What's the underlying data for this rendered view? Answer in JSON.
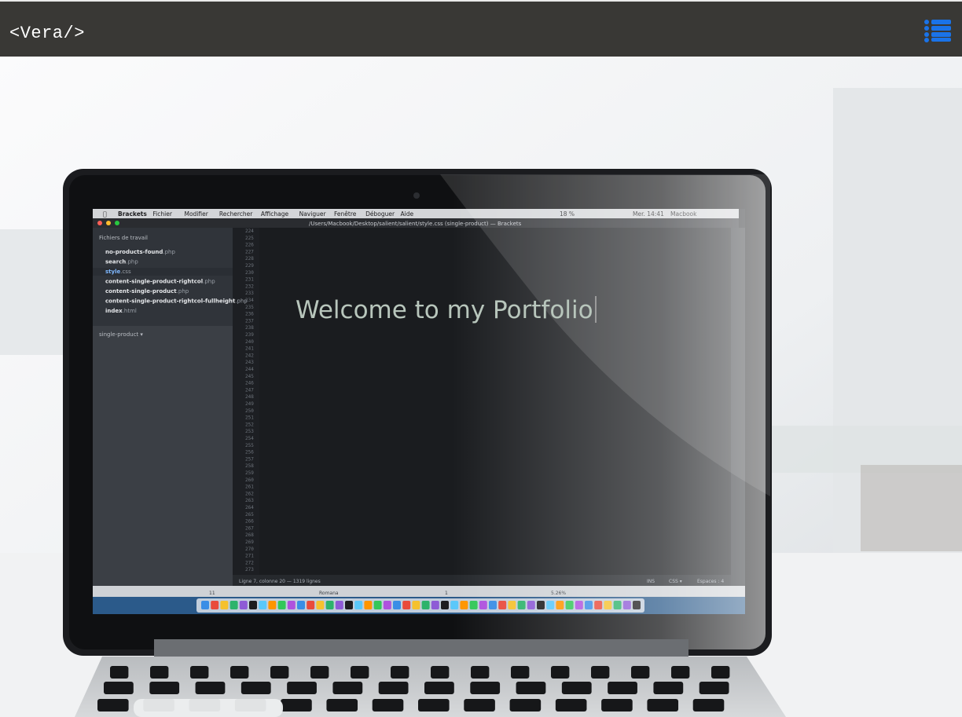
{
  "navbar": {
    "brand": "<Vera/>",
    "menu_icon": "list-icon",
    "accent_color": "#1a73e8",
    "background_color": "#393835"
  },
  "hero": {
    "headline": "Welcome to my Portfolio",
    "background_image": "laptop showing code editor on a white desk"
  },
  "editor_screen": {
    "menubar": [
      "Brackets",
      "Fichier",
      "Modifier",
      "Rechercher",
      "Affichage",
      "Naviguer",
      "Fenêtre",
      "Déboguer",
      "Aide"
    ],
    "window_title": "/Users/Macbook/Desktop/salient/salient/style.css (single-product) — Brackets",
    "clock": "Mer. 14:41",
    "user": "Macbook",
    "battery": "18 %",
    "sidebar_title": "Fichiers de travail",
    "files": [
      {
        "name": "no-products-found",
        "ext": ".php"
      },
      {
        "name": "search",
        "ext": ".php"
      },
      {
        "name": "style",
        "ext": ".css"
      },
      {
        "name": "content-single-product-rightcol",
        "ext": ".php"
      },
      {
        "name": "content-single-product",
        "ext": ".php"
      },
      {
        "name": "content-single-product-rightcol-fullheight",
        "ext": ".php"
      },
      {
        "name": "index",
        "ext": ".html"
      }
    ],
    "project_label": "single-product ▾",
    "statusbar_left": "Ligne 7, colonne 20 — 1319 lignes",
    "statusbar_right": [
      "INS",
      "CSS ▾",
      "Espaces : 4"
    ],
    "second_bar": [
      "11",
      "Romana",
      "1",
      "5.26%"
    ]
  }
}
